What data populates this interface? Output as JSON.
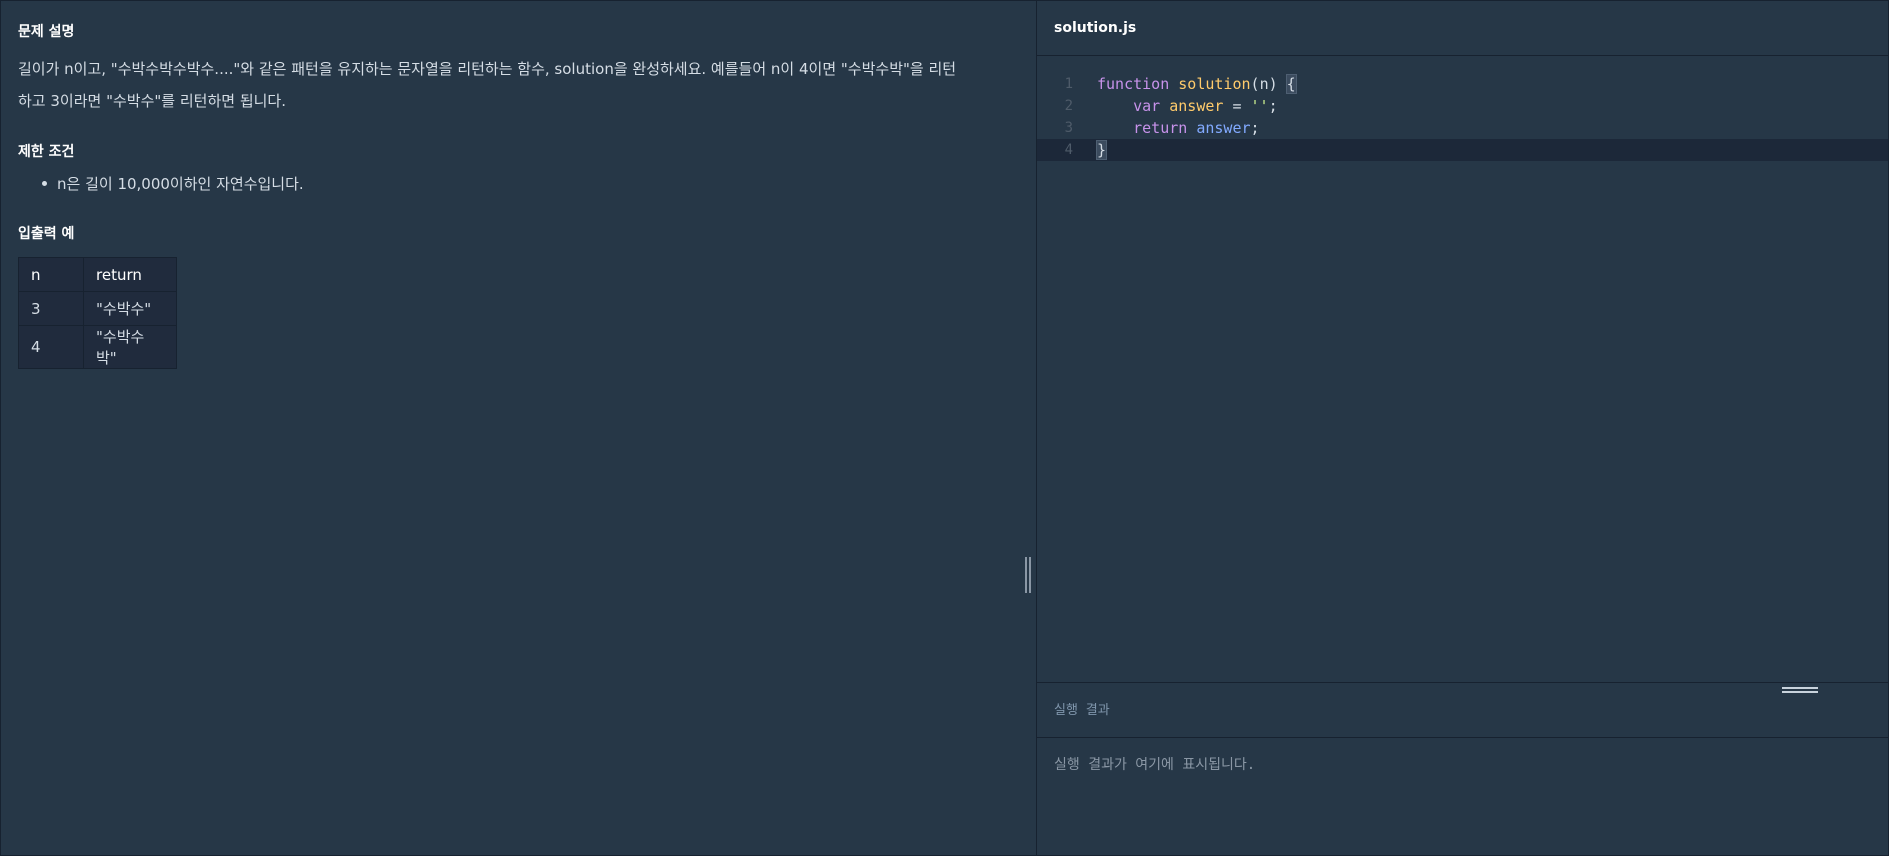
{
  "problem": {
    "description_title": "문제 설명",
    "description_line1": "길이가 n이고, \"수박수박수박수....\"와 같은 패턴을 유지하는 문자열을 리턴하는 함수, solution을 완성하세요. 예를들어 n이 4이면 \"수박수박\"을 리턴",
    "description_line2": "하고 3이라면 \"수박수\"를 리턴하면 됩니다.",
    "constraints_title": "제한 조건",
    "constraints": [
      "n은 길이 10,000이하인 자연수입니다."
    ],
    "io_title": "입출력 예",
    "io_table": {
      "headers": [
        "n",
        "return"
      ],
      "rows": [
        [
          "3",
          "\"수박수\""
        ],
        [
          "4",
          "\"수박수박\""
        ]
      ]
    }
  },
  "editor": {
    "filename": "solution.js",
    "line_numbers": [
      "1",
      "2",
      "3",
      "4"
    ],
    "code": {
      "l1_kw": "function",
      "l1_fn": "solution",
      "l1_paren_open": "(",
      "l1_param": "n",
      "l1_paren_close": ")",
      "l1_brace": "{",
      "l2_kw": "var",
      "l2_var": "answer",
      "l2_op": " = ",
      "l2_str": "''",
      "l2_semi": ";",
      "l3_kw": "return",
      "l3_var": "answer",
      "l3_semi": ";",
      "l4_brace": "}"
    }
  },
  "result": {
    "title": "실행 결과",
    "placeholder": "실행 결과가 여기에 표시됩니다."
  },
  "colors": {
    "background": "#263747",
    "keyword": "#c792ea",
    "function": "#ffcb6b",
    "variable": "#82aaff",
    "string": "#c3e88d"
  }
}
